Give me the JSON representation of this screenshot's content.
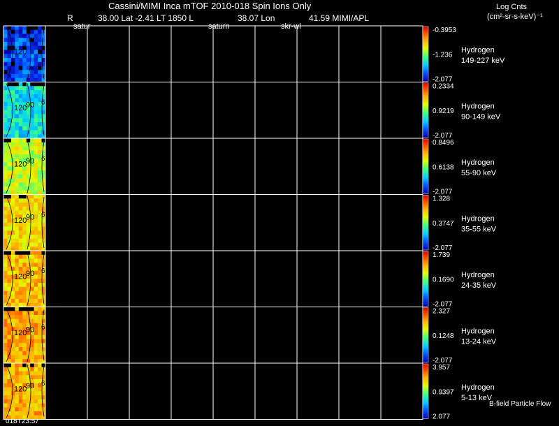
{
  "header": {
    "title": "Cassini/MIMI Inca mTOF  2010-018   Spin    Ions Only",
    "subtitle_r": "R",
    "subtitle_mid": "38.00 Lat -2.41 LT 1850 L",
    "subtitle_lon": "38.07 Lon",
    "subtitle_right": "41.59  MIMI/APL",
    "satur_label_1": "satur",
    "satur_label_2": "saturn",
    "satur_label_3": "skr-wl",
    "colorbar_title": "Log Cnts",
    "colorbar_units": "(cm²-sr-s-keV)⁻¹"
  },
  "footer": {
    "timestamp": "018T23:57",
    "legend_label": "B-field Particle Flow"
  },
  "colors": {
    "background": "#000000",
    "grid": "#ffffff",
    "text": "#ffffff"
  },
  "chart_data": {
    "type": "heatmap",
    "panels": [
      {
        "species": "Hydrogen",
        "energy": "149-227 keV",
        "cb_max": "-0.3953",
        "cb_mid": "-1.236",
        "cb_min": "-2.077",
        "level": 0.12,
        "angle_a": "120",
        "angle_b": "",
        "angle_c": ""
      },
      {
        "species": "Hydrogen",
        "energy": "90-149 keV",
        "cb_max": "0.2334",
        "cb_mid": "0.9219",
        "cb_min": "-2.077",
        "level": 0.35,
        "angle_a": "120",
        "angle_b": "90",
        "angle_c": "6"
      },
      {
        "species": "Hydrogen",
        "energy": "55-90 keV",
        "cb_max": "0.8496",
        "cb_mid": "0.6138",
        "cb_min": "-2.077",
        "level": 0.58,
        "angle_a": "120",
        "angle_b": "90",
        "angle_c": "6"
      },
      {
        "species": "Hydrogen",
        "energy": "35-55 keV",
        "cb_max": "1.328",
        "cb_mid": "0.3747",
        "cb_min": "-2.077",
        "level": 0.68,
        "angle_a": "120",
        "angle_b": "90",
        "angle_c": "6"
      },
      {
        "species": "Hydrogen",
        "energy": "24-35 keV",
        "cb_max": "1.739",
        "cb_mid": "0.1690",
        "cb_min": "-2.077",
        "level": 0.72,
        "angle_a": "120",
        "angle_b": "90",
        "angle_c": "6"
      },
      {
        "species": "Hydrogen",
        "energy": "13-24 keV",
        "cb_max": "2.327",
        "cb_mid": "0.1248",
        "cb_min": "-2.077",
        "level": 0.76,
        "angle_a": "120",
        "angle_b": "90",
        "angle_c": "6"
      },
      {
        "species": "Hydrogen",
        "energy": "5-13 keV",
        "cb_max": "3.957",
        "cb_mid": "0.9397",
        "cb_min": "2.077",
        "level": 0.74,
        "angle_a": "120",
        "angle_b": "90",
        "angle_c": "6"
      }
    ]
  }
}
